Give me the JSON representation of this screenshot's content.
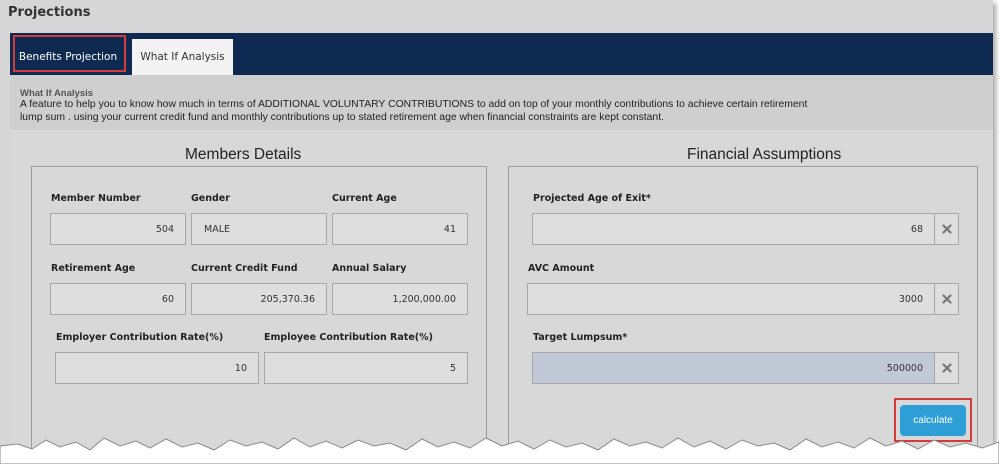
{
  "page": {
    "title": "Projections"
  },
  "tabs": [
    {
      "label": "Benefits Projection",
      "active": false
    },
    {
      "label": "What If Analysis",
      "active": true
    }
  ],
  "intro": {
    "heading": "What If Analysis",
    "text": "A feature to help you to know how much in terms of ADDITIONAL VOLUNTARY CONTRIBUTIONS to add on top of your monthly contributions to achieve certain retirement lump sum . using your current credit fund and monthly contributions up to stated retirement age when financial constraints are kept constant."
  },
  "members": {
    "title": "Members Details",
    "member_number": {
      "label": "Member Number",
      "value": "504"
    },
    "gender": {
      "label": "Gender",
      "value": "MALE"
    },
    "current_age": {
      "label": "Current Age",
      "value": "41"
    },
    "retirement_age": {
      "label": "Retirement Age",
      "value": "60"
    },
    "current_credit_fund": {
      "label": "Current Credit Fund",
      "value": "205,370.36"
    },
    "annual_salary": {
      "label": "Annual Salary",
      "value": "1,200,000.00"
    },
    "employer_rate": {
      "label": "Employer Contribution Rate(%)",
      "value": "10"
    },
    "employee_rate": {
      "label": "Employee Contribution Rate(%)",
      "value": "5"
    }
  },
  "financial": {
    "title": "Financial Assumptions",
    "projected_age_of_exit": {
      "label": "Projected Age of Exit*",
      "value": "68"
    },
    "avc_amount": {
      "label": "AVC Amount",
      "value": "3000"
    },
    "target_lumpsum": {
      "label": "Target Lumpsum*",
      "value": "500000"
    },
    "calculate_label": "calculate"
  },
  "icons": {
    "clear": "close-icon"
  },
  "colors": {
    "tab_bar": "#0e2a50",
    "button": "#2d9fd6",
    "highlight": "#d33a3a"
  }
}
